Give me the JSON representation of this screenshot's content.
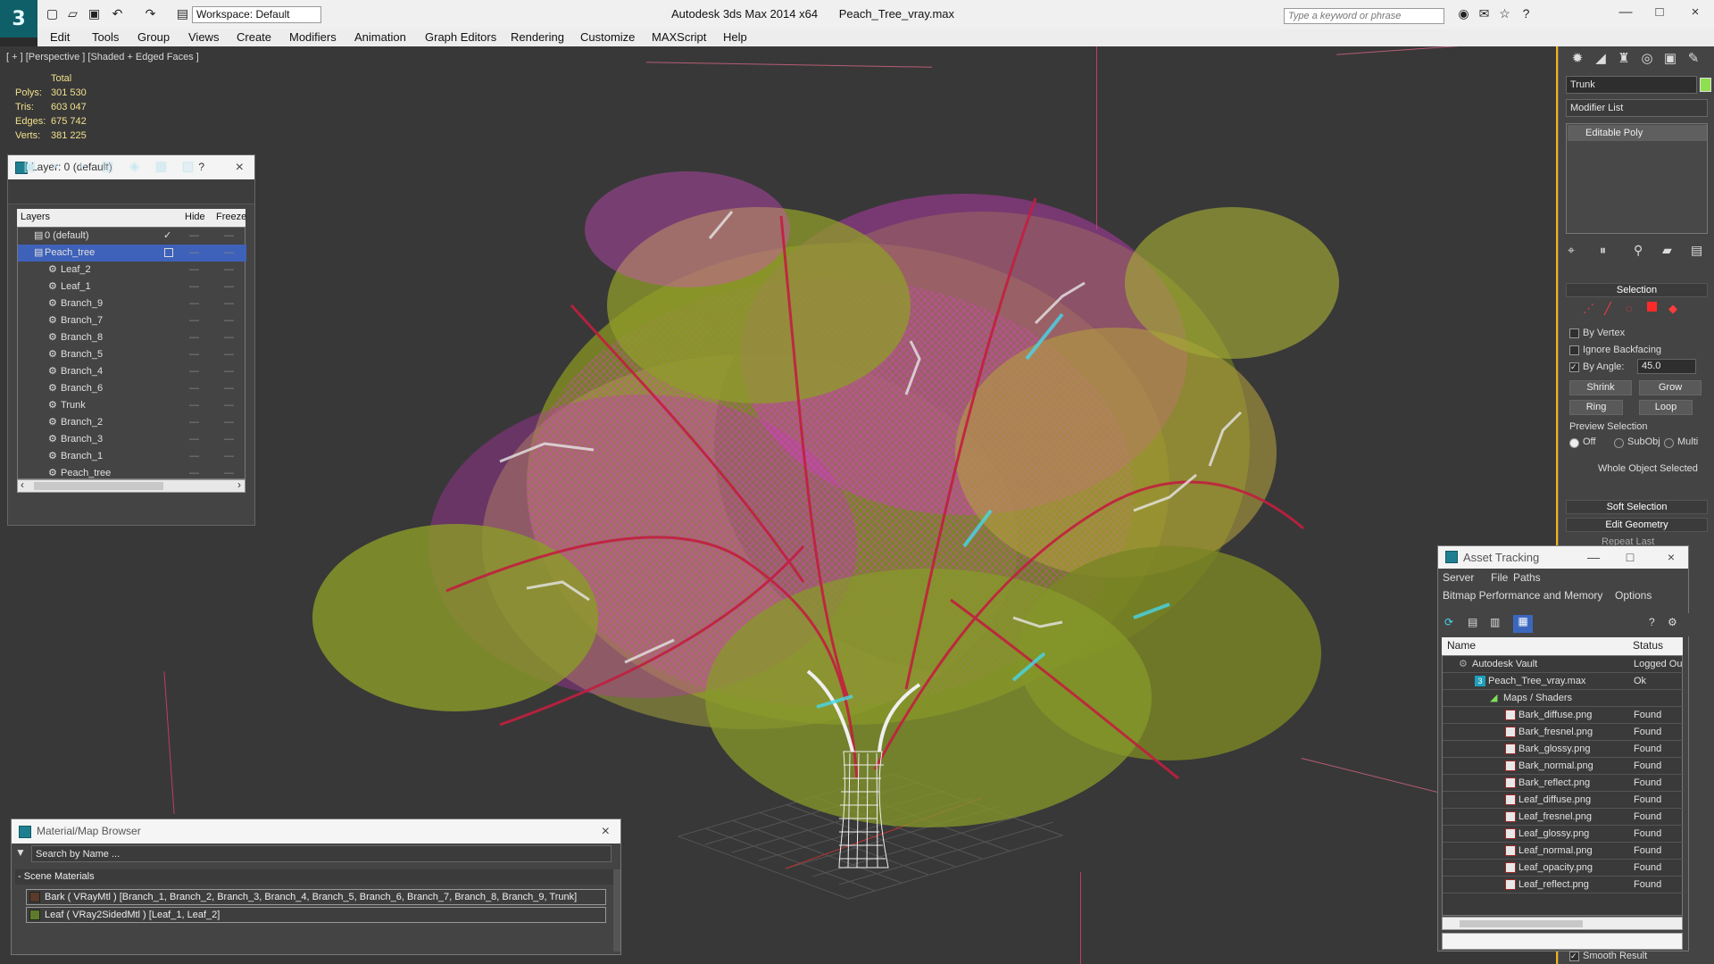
{
  "app": {
    "title": "Autodesk 3ds Max  2014 x64",
    "file_title": "Peach_Tree_vray.max",
    "workspace": "Workspace: Default",
    "search_placeholder": "Type a keyword or phrase",
    "logo": "3"
  },
  "menu": [
    "Edit",
    "Tools",
    "Group",
    "Views",
    "Create",
    "Modifiers",
    "Animation",
    "Graph Editors",
    "Rendering",
    "Customize",
    "MAXScript",
    "Help"
  ],
  "viewport": {
    "label": "[ + ] [Perspective ] [Shaded + Edged Faces ]",
    "stats_title": "Total",
    "stats": [
      {
        "label": "Polys:",
        "value": "301 530"
      },
      {
        "label": "Tris:",
        "value": "603 047"
      },
      {
        "label": "Edges:",
        "value": "675 742"
      },
      {
        "label": "Verts:",
        "value": "381 225"
      }
    ]
  },
  "layer_dialog": {
    "title": "Layer: 0 (default)",
    "help": "?",
    "columns": {
      "layers": "Layers",
      "hide": "Hide",
      "freeze": "Freeze"
    },
    "dots": "—",
    "items": [
      {
        "name": "0 (default)",
        "indent": 0
      },
      {
        "name": "Peach_tree",
        "indent": 0,
        "selected": true
      },
      {
        "name": "Leaf_2",
        "indent": 1
      },
      {
        "name": "Leaf_1",
        "indent": 1
      },
      {
        "name": "Branch_9",
        "indent": 1
      },
      {
        "name": "Branch_7",
        "indent": 1
      },
      {
        "name": "Branch_8",
        "indent": 1
      },
      {
        "name": "Branch_5",
        "indent": 1
      },
      {
        "name": "Branch_4",
        "indent": 1
      },
      {
        "name": "Branch_6",
        "indent": 1
      },
      {
        "name": "Trunk",
        "indent": 1
      },
      {
        "name": "Branch_2",
        "indent": 1
      },
      {
        "name": "Branch_3",
        "indent": 1
      },
      {
        "name": "Branch_1",
        "indent": 1
      },
      {
        "name": "Peach_tree",
        "indent": 1
      }
    ]
  },
  "command_panel": {
    "object_name": "Trunk",
    "modifier_list": "Modifier List",
    "stack_item": "Editable Poly",
    "rollouts": {
      "selection": "Selection",
      "soft_selection": "Soft Selection",
      "edit_geometry": "Edit Geometry",
      "repeat_last": "Repeat Last"
    },
    "options": {
      "by_vertex": "By Vertex",
      "ignore_backfacing": "Ignore Backfacing",
      "by_angle": "By Angle:",
      "angle_value": "45.0",
      "shrink": "Shrink",
      "grow": "Grow",
      "ring": "Ring",
      "loop": "Loop",
      "preview_selection": "Preview Selection",
      "off": "Off",
      "subobj": "SubObj",
      "multi": "Multi",
      "whole_object": "Whole Object Selected",
      "smooth_result": "Smooth Result"
    }
  },
  "asset_tracking": {
    "title": "Asset Tracking",
    "menus": [
      "Server",
      "File",
      "Paths",
      "Bitmap Performance and Memory",
      "Options"
    ],
    "columns": {
      "name": "Name",
      "status": "Status"
    },
    "rows": [
      {
        "name": "Autodesk Vault",
        "status": "Logged Ou",
        "level": 0
      },
      {
        "name": "Peach_Tree_vray.max",
        "status": "Ok",
        "level": 1
      },
      {
        "name": "Maps / Shaders",
        "status": "",
        "level": 2
      },
      {
        "name": "Bark_diffuse.png",
        "status": "Found",
        "level": 3
      },
      {
        "name": "Bark_fresnel.png",
        "status": "Found",
        "level": 3
      },
      {
        "name": "Bark_glossy.png",
        "status": "Found",
        "level": 3
      },
      {
        "name": "Bark_normal.png",
        "status": "Found",
        "level": 3
      },
      {
        "name": "Bark_reflect.png",
        "status": "Found",
        "level": 3
      },
      {
        "name": "Leaf_diffuse.png",
        "status": "Found",
        "level": 3
      },
      {
        "name": "Leaf_fresnel.png",
        "status": "Found",
        "level": 3
      },
      {
        "name": "Leaf_glossy.png",
        "status": "Found",
        "level": 3
      },
      {
        "name": "Leaf_normal.png",
        "status": "Found",
        "level": 3
      },
      {
        "name": "Leaf_opacity.png",
        "status": "Found",
        "level": 3
      },
      {
        "name": "Leaf_reflect.png",
        "status": "Found",
        "level": 3
      }
    ]
  },
  "material_browser": {
    "title": "Material/Map Browser",
    "search_placeholder": "Search by Name ...",
    "section": "- Scene Materials",
    "items": [
      {
        "label": "Bark  ( VRayMtl )  [Branch_1, Branch_2, Branch_3, Branch_4, Branch_5, Branch_6, Branch_7, Branch_8, Branch_9, Trunk]",
        "swatch": "#5a3a28"
      },
      {
        "label": "Leaf  ( VRay2SidedMtl )  [Leaf_1, Leaf_2]",
        "swatch": "#5e7a2b"
      }
    ]
  },
  "colors": {
    "viewport": "#383838",
    "accent": "#1e7f90",
    "leaf_green": "#9aa12f",
    "wire_magenta": "#e43bd6",
    "branch_red": "#c21f3f",
    "selection": "#2a62cc"
  }
}
